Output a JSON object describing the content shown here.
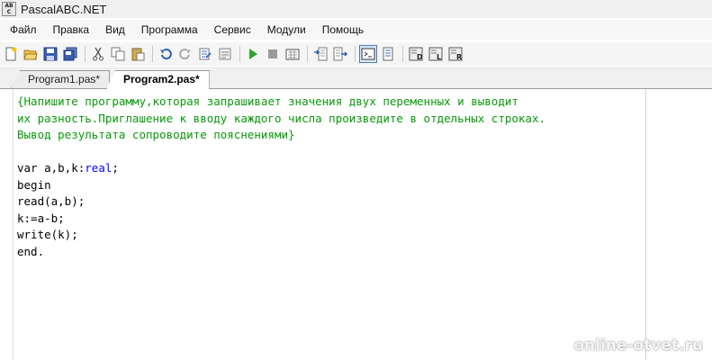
{
  "window": {
    "title": "PascalABC.NET",
    "icon": "pascalabc-app-icon"
  },
  "menu": {
    "items": [
      "Файл",
      "Правка",
      "Вид",
      "Программа",
      "Сервис",
      "Модули",
      "Помощь"
    ]
  },
  "toolbar": {
    "buttons": [
      "new-file-icon",
      "open-folder-icon",
      "save-icon",
      "save-all-icon",
      "cut-icon",
      "copy-icon",
      "paste-icon",
      "undo-icon",
      "redo-icon",
      "find-icon",
      "replace-icon",
      "run-icon",
      "stop-icon",
      "compile-icon",
      "step-into-icon",
      "step-over-icon",
      "output-window-icon",
      "properties-icon",
      "debug-d-icon",
      "debug-l-icon",
      "debug-r-icon"
    ]
  },
  "tabs": [
    {
      "label": "Program1.pas*",
      "active": false
    },
    {
      "label": "Program2.pas*",
      "active": true
    }
  ],
  "editor": {
    "comment_lines": [
      "{Напишите программу,которая запрашивает значения двух переменных и выводит",
      "их разность.Приглашение к вводу каждого числа произведите в отдельных строках.",
      "Вывод результата сопроводите пояснениями}"
    ],
    "var_line_prefix": "var a,b,k:",
    "var_line_type": "real",
    "var_line_suffix": ";",
    "body_lines": [
      "begin",
      "read(a,b);",
      "k:=a-b;",
      "write(k);",
      "end."
    ]
  },
  "watermark": "online-otvet.ru",
  "colors": {
    "comment": "#0a9a0a",
    "keyword_type": "#0000ff",
    "run_green": "#2aa52a"
  }
}
